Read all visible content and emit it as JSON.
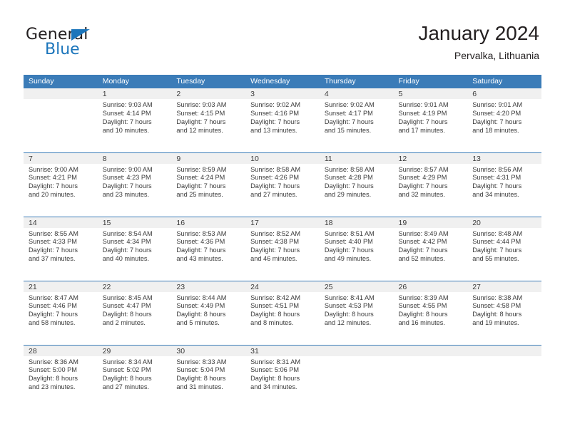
{
  "logo": {
    "word_one": "General",
    "word_two": "Blue",
    "triangle_icon": "blue-triangle-icon",
    "color_dark": "#231f20",
    "color_blue": "#1b75bb"
  },
  "header": {
    "title": "January 2024",
    "subtitle": "Pervalka, Lithuania"
  },
  "theme": {
    "header_blue": "#3b7cb8",
    "daynum_band": "#f0f0f0",
    "text": "#3a3a3a"
  },
  "weekday_headers": [
    "Sunday",
    "Monday",
    "Tuesday",
    "Wednesday",
    "Thursday",
    "Friday",
    "Saturday"
  ],
  "weeks": [
    [
      {
        "day": "",
        "lines": []
      },
      {
        "day": "1",
        "lines": [
          "Sunrise: 9:03 AM",
          "Sunset: 4:14 PM",
          "Daylight: 7 hours",
          "and 10 minutes."
        ]
      },
      {
        "day": "2",
        "lines": [
          "Sunrise: 9:03 AM",
          "Sunset: 4:15 PM",
          "Daylight: 7 hours",
          "and 12 minutes."
        ]
      },
      {
        "day": "3",
        "lines": [
          "Sunrise: 9:02 AM",
          "Sunset: 4:16 PM",
          "Daylight: 7 hours",
          "and 13 minutes."
        ]
      },
      {
        "day": "4",
        "lines": [
          "Sunrise: 9:02 AM",
          "Sunset: 4:17 PM",
          "Daylight: 7 hours",
          "and 15 minutes."
        ]
      },
      {
        "day": "5",
        "lines": [
          "Sunrise: 9:01 AM",
          "Sunset: 4:19 PM",
          "Daylight: 7 hours",
          "and 17 minutes."
        ]
      },
      {
        "day": "6",
        "lines": [
          "Sunrise: 9:01 AM",
          "Sunset: 4:20 PM",
          "Daylight: 7 hours",
          "and 18 minutes."
        ]
      }
    ],
    [
      {
        "day": "7",
        "lines": [
          "Sunrise: 9:00 AM",
          "Sunset: 4:21 PM",
          "Daylight: 7 hours",
          "and 20 minutes."
        ]
      },
      {
        "day": "8",
        "lines": [
          "Sunrise: 9:00 AM",
          "Sunset: 4:23 PM",
          "Daylight: 7 hours",
          "and 23 minutes."
        ]
      },
      {
        "day": "9",
        "lines": [
          "Sunrise: 8:59 AM",
          "Sunset: 4:24 PM",
          "Daylight: 7 hours",
          "and 25 minutes."
        ]
      },
      {
        "day": "10",
        "lines": [
          "Sunrise: 8:58 AM",
          "Sunset: 4:26 PM",
          "Daylight: 7 hours",
          "and 27 minutes."
        ]
      },
      {
        "day": "11",
        "lines": [
          "Sunrise: 8:58 AM",
          "Sunset: 4:28 PM",
          "Daylight: 7 hours",
          "and 29 minutes."
        ]
      },
      {
        "day": "12",
        "lines": [
          "Sunrise: 8:57 AM",
          "Sunset: 4:29 PM",
          "Daylight: 7 hours",
          "and 32 minutes."
        ]
      },
      {
        "day": "13",
        "lines": [
          "Sunrise: 8:56 AM",
          "Sunset: 4:31 PM",
          "Daylight: 7 hours",
          "and 34 minutes."
        ]
      }
    ],
    [
      {
        "day": "14",
        "lines": [
          "Sunrise: 8:55 AM",
          "Sunset: 4:33 PM",
          "Daylight: 7 hours",
          "and 37 minutes."
        ]
      },
      {
        "day": "15",
        "lines": [
          "Sunrise: 8:54 AM",
          "Sunset: 4:34 PM",
          "Daylight: 7 hours",
          "and 40 minutes."
        ]
      },
      {
        "day": "16",
        "lines": [
          "Sunrise: 8:53 AM",
          "Sunset: 4:36 PM",
          "Daylight: 7 hours",
          "and 43 minutes."
        ]
      },
      {
        "day": "17",
        "lines": [
          "Sunrise: 8:52 AM",
          "Sunset: 4:38 PM",
          "Daylight: 7 hours",
          "and 46 minutes."
        ]
      },
      {
        "day": "18",
        "lines": [
          "Sunrise: 8:51 AM",
          "Sunset: 4:40 PM",
          "Daylight: 7 hours",
          "and 49 minutes."
        ]
      },
      {
        "day": "19",
        "lines": [
          "Sunrise: 8:49 AM",
          "Sunset: 4:42 PM",
          "Daylight: 7 hours",
          "and 52 minutes."
        ]
      },
      {
        "day": "20",
        "lines": [
          "Sunrise: 8:48 AM",
          "Sunset: 4:44 PM",
          "Daylight: 7 hours",
          "and 55 minutes."
        ]
      }
    ],
    [
      {
        "day": "21",
        "lines": [
          "Sunrise: 8:47 AM",
          "Sunset: 4:46 PM",
          "Daylight: 7 hours",
          "and 58 minutes."
        ]
      },
      {
        "day": "22",
        "lines": [
          "Sunrise: 8:45 AM",
          "Sunset: 4:47 PM",
          "Daylight: 8 hours",
          "and 2 minutes."
        ]
      },
      {
        "day": "23",
        "lines": [
          "Sunrise: 8:44 AM",
          "Sunset: 4:49 PM",
          "Daylight: 8 hours",
          "and 5 minutes."
        ]
      },
      {
        "day": "24",
        "lines": [
          "Sunrise: 8:42 AM",
          "Sunset: 4:51 PM",
          "Daylight: 8 hours",
          "and 8 minutes."
        ]
      },
      {
        "day": "25",
        "lines": [
          "Sunrise: 8:41 AM",
          "Sunset: 4:53 PM",
          "Daylight: 8 hours",
          "and 12 minutes."
        ]
      },
      {
        "day": "26",
        "lines": [
          "Sunrise: 8:39 AM",
          "Sunset: 4:55 PM",
          "Daylight: 8 hours",
          "and 16 minutes."
        ]
      },
      {
        "day": "27",
        "lines": [
          "Sunrise: 8:38 AM",
          "Sunset: 4:58 PM",
          "Daylight: 8 hours",
          "and 19 minutes."
        ]
      }
    ],
    [
      {
        "day": "28",
        "lines": [
          "Sunrise: 8:36 AM",
          "Sunset: 5:00 PM",
          "Daylight: 8 hours",
          "and 23 minutes."
        ]
      },
      {
        "day": "29",
        "lines": [
          "Sunrise: 8:34 AM",
          "Sunset: 5:02 PM",
          "Daylight: 8 hours",
          "and 27 minutes."
        ]
      },
      {
        "day": "30",
        "lines": [
          "Sunrise: 8:33 AM",
          "Sunset: 5:04 PM",
          "Daylight: 8 hours",
          "and 31 minutes."
        ]
      },
      {
        "day": "31",
        "lines": [
          "Sunrise: 8:31 AM",
          "Sunset: 5:06 PM",
          "Daylight: 8 hours",
          "and 34 minutes."
        ]
      },
      {
        "day": "",
        "lines": []
      },
      {
        "day": "",
        "lines": []
      },
      {
        "day": "",
        "lines": []
      }
    ]
  ]
}
